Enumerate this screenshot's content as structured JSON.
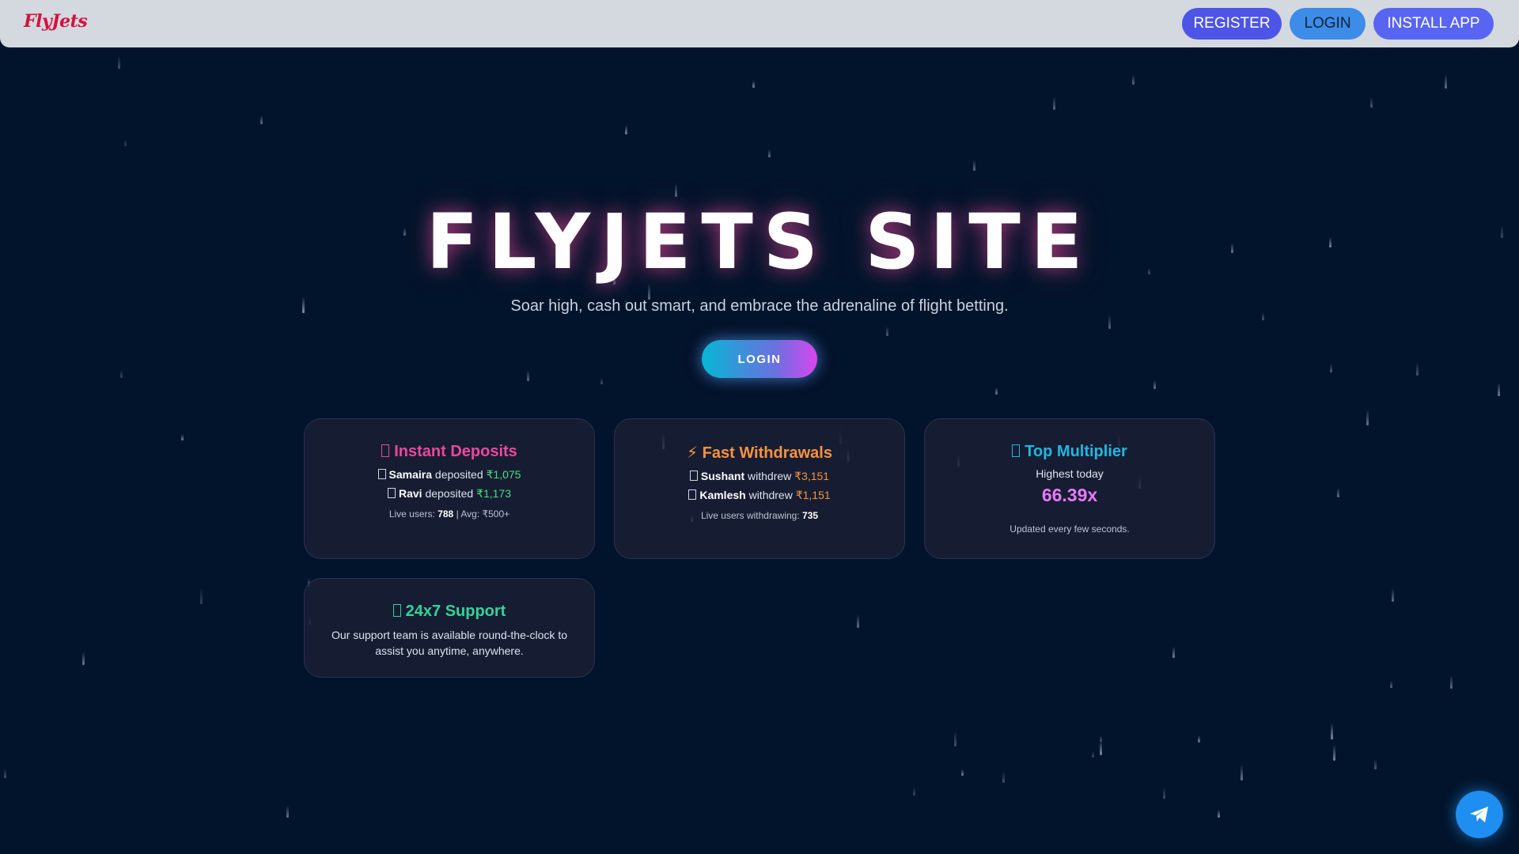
{
  "header": {
    "logo": "FlyJets",
    "register_label": "REGISTER",
    "login_label": "LOGIN",
    "install_label": "INSTALL APP"
  },
  "hero": {
    "title": "FLYJETS SITE",
    "subtitle": "Soar high, cash out smart, and embrace the adrenaline of flight betting.",
    "login_label": "LOGIN"
  },
  "cards": {
    "deposits": {
      "title": "Instant Deposits",
      "icon": "money-icon",
      "entries": [
        {
          "name": "Samaira",
          "verb": "deposited",
          "amount": "₹1,075"
        },
        {
          "name": "Ravi",
          "verb": "deposited",
          "amount": "₹1,173"
        }
      ],
      "footer_prefix": "Live users:",
      "live_users": "788",
      "footer_suffix": "| Avg: ₹500+"
    },
    "withdrawals": {
      "title": "Fast Withdrawals",
      "icon": "lightning-icon",
      "entries": [
        {
          "name": "Sushant",
          "verb": "withdrew",
          "amount": "₹3,151"
        },
        {
          "name": "Kamlesh",
          "verb": "withdrew",
          "amount": "₹1,151"
        }
      ],
      "footer_prefix": "Live users withdrawing:",
      "live_users": "735"
    },
    "multiplier": {
      "title": "Top Multiplier",
      "icon": "rocket-icon",
      "label": "Highest today",
      "value": "66.39x",
      "note": "Updated every few seconds."
    },
    "support": {
      "title": "24x7 Support",
      "icon": "support-icon",
      "text": "Our support team is available round-the-clock to assist you anytime, anywhere."
    }
  },
  "fab": {
    "icon": "telegram-icon"
  },
  "colors": {
    "background": "#02142b",
    "header": "#d4d9e0",
    "logo": "#d3133d",
    "register": "#4d55e6",
    "login": "#3c8ce8",
    "install": "#5865f2",
    "deposits_title": "#ec4899",
    "withdrawals_title": "#fb923c",
    "multiplier_title": "#22b7e0",
    "support_title": "#34d399",
    "multiplier_value": "#e879f9"
  }
}
